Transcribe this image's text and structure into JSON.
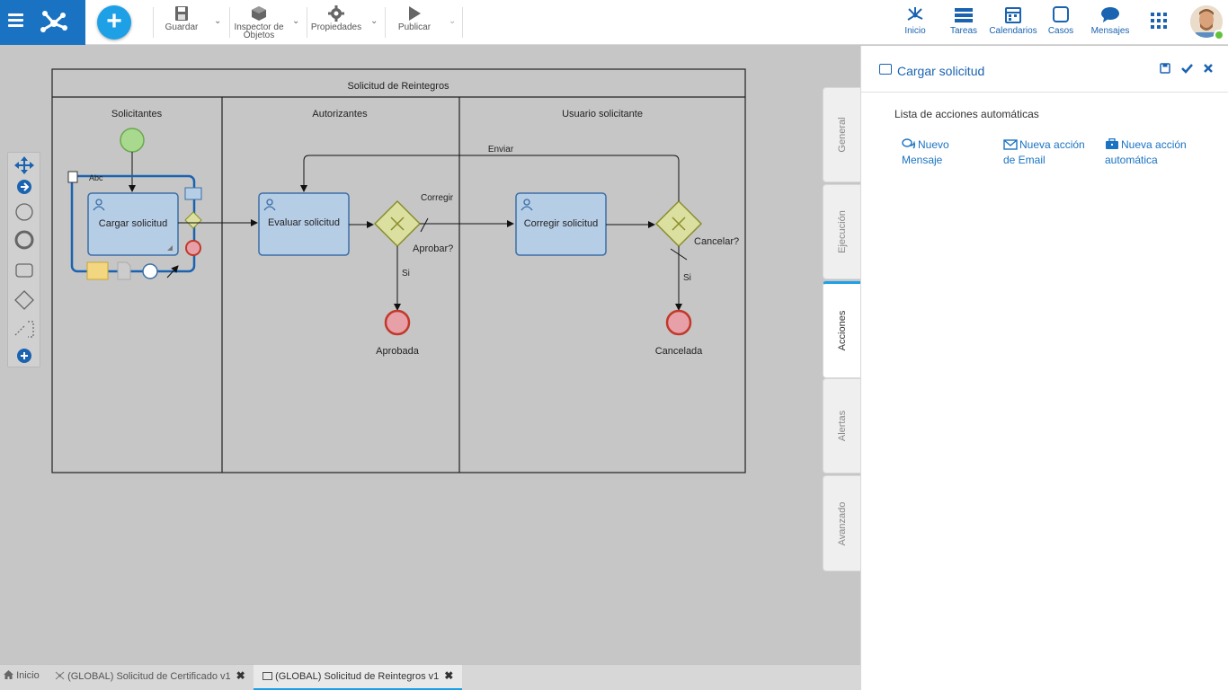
{
  "toolbar": {
    "save": "Guardar",
    "inspector_line1": "Inspector de",
    "inspector_line2": "Objetos",
    "properties": "Propiedades",
    "publish": "Publicar"
  },
  "nav": {
    "home": "Inicio",
    "tasks": "Tareas",
    "calendars": "Calendarios",
    "cases": "Casos",
    "messages": "Mensajes"
  },
  "diagram": {
    "pool_title": "Solicitud de Reintegros",
    "lanes": [
      "Solicitantes",
      "Autorizantes",
      "Usuario solicitante"
    ],
    "tasks": {
      "load": "Cargar solicitud",
      "evaluate": "Evaluar solicitud",
      "correct": "Corregir solicitud"
    },
    "labels": {
      "send": "Enviar",
      "correct_flow": "Corregir",
      "approve_q": "Aprobar?",
      "cancel_q": "Cancelar?",
      "yes1": "Si",
      "yes2": "Si",
      "approved": "Aprobada",
      "cancelled": "Cancelada",
      "abc": "Abc"
    }
  },
  "side_tabs": [
    "General",
    "Ejecución",
    "Acciones",
    "Alertas",
    "Avanzado"
  ],
  "panel": {
    "title": "Cargar solicitud",
    "list_title": "Lista de acciones automáticas",
    "actions": [
      {
        "line1": "Nuevo",
        "line2": "Mensaje",
        "icon": "comments-icon"
      },
      {
        "line1": "Nueva acción",
        "line2": "de Email",
        "icon": "envelope-icon"
      },
      {
        "line1": "Nueva acción",
        "line2": "automática",
        "icon": "briefcase-icon"
      }
    ]
  },
  "bottom_tabs": [
    {
      "label": "Inicio"
    },
    {
      "label": "(GLOBAL) Solicitud de Certificado v1"
    },
    {
      "label": "(GLOBAL) Solicitud de Reintegros v1"
    }
  ],
  "colors": {
    "brand_blue": "#1a73c2",
    "accent": "#1ea0e6",
    "task_fill": "#b6cde6",
    "gateway_fill": "#dbe0a0",
    "start_fill": "#a9d98f",
    "end_fill": "#e8a0a8"
  }
}
